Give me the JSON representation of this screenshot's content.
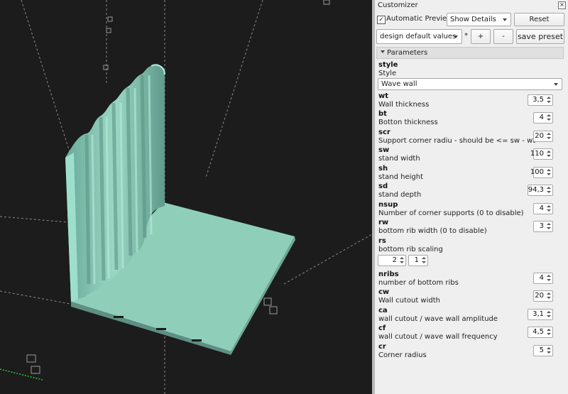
{
  "panel": {
    "title": "Customizer",
    "automatic_preview_label": "Automatic Preview",
    "automatic_preview_checked": "✓",
    "show_details": "Show Details",
    "reset_label": "Reset",
    "preset_selected": "design default values",
    "asterisk": "*",
    "add_label": "+",
    "remove_label": "-",
    "save_preset_label": "save preset",
    "group_label": "Parameters",
    "style": {
      "name": "style",
      "desc": "Style",
      "value": "Wave wall"
    },
    "params": [
      {
        "name": "wt",
        "desc": "Wall thickness",
        "value": "3,5"
      },
      {
        "name": "bt",
        "desc": "Botton thickness",
        "value": "4"
      },
      {
        "name": "scr",
        "desc": "Support corner radiu - should be <= sw - wt",
        "value": "20"
      },
      {
        "name": "sw",
        "desc": "stand width",
        "value": "110"
      },
      {
        "name": "sh",
        "desc": "stand height",
        "value": "100"
      },
      {
        "name": "sd",
        "desc": "stand depth",
        "value": "94,3"
      },
      {
        "name": "nsup",
        "desc": "Number of corner supports (0 to disable)",
        "value": "4"
      },
      {
        "name": "rw",
        "desc": "bottom rib width (0 to disable)",
        "value": "3"
      }
    ],
    "rs": {
      "name": "rs",
      "desc": "bottom rib scaling",
      "values": [
        "2",
        "1"
      ]
    },
    "params2": [
      {
        "name": "nribs",
        "desc": "number of bottom ribs",
        "value": "4"
      },
      {
        "name": "cw",
        "desc": "Wall cutout width",
        "value": "20"
      },
      {
        "name": "ca",
        "desc": "wall cutout / wave wall amplitude",
        "value": "3,1"
      },
      {
        "name": "cf",
        "desc": "wall cutout / wave wall frequency",
        "value": "4,5"
      },
      {
        "name": "cr",
        "desc": "Corner radius",
        "value": "5"
      }
    ]
  },
  "colors": {
    "model": "#8fcfba",
    "background": "#1c1c1c",
    "grid": "#8a8a8a"
  }
}
